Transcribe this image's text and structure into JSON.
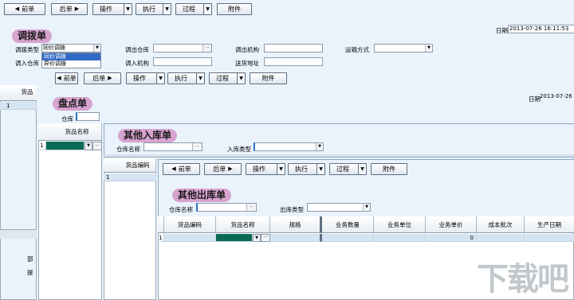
{
  "toolbar": {
    "prev": "前单",
    "next": "后单",
    "operate": "操作",
    "execute": "执行",
    "process": "过程",
    "attach": "附件"
  },
  "diaobo": {
    "title": "调拨单",
    "date_label": "日期",
    "date_value": "2013-07-26 16:11:53",
    "type_label": "调拨类型",
    "type_value": "同价调拨",
    "type_options": [
      "同价调拨",
      "异价调拨"
    ],
    "out_wh_label": "调出仓库",
    "out_org_label": "调出机构",
    "ship_label": "运输方式",
    "in_wh_label": "调入仓库",
    "in_org_label": "调入机构",
    "addr_label": "送货地址"
  },
  "pandian": {
    "title": "盘点单",
    "date_label": "日期",
    "date_value": "2013-07-26",
    "wh_label": "仓库",
    "col_name": "货品名称",
    "row_no": "1"
  },
  "qita_in": {
    "title": "其他入库单",
    "wh_label": "仓库名称",
    "type_label": "入库类型",
    "col_code": "货品编码",
    "row_no": "1"
  },
  "qita_out": {
    "title": "其他出库单",
    "wh_label": "仓库名称",
    "type_label": "出库类型",
    "columns": [
      "货品编码",
      "货品名称",
      "规格",
      "业务数量",
      "业务单位",
      "业务单价",
      "成本批次",
      "生产日期"
    ],
    "row_no": "1",
    "price_value": "0"
  },
  "bg": {
    "row_no": "1",
    "col_partial": "货品",
    "side_a": "部",
    "side_b": "提"
  },
  "watermark": "下载吧",
  "icons": {
    "prev": "◀",
    "next": "▶",
    "dd": "▼",
    "more": "···"
  }
}
